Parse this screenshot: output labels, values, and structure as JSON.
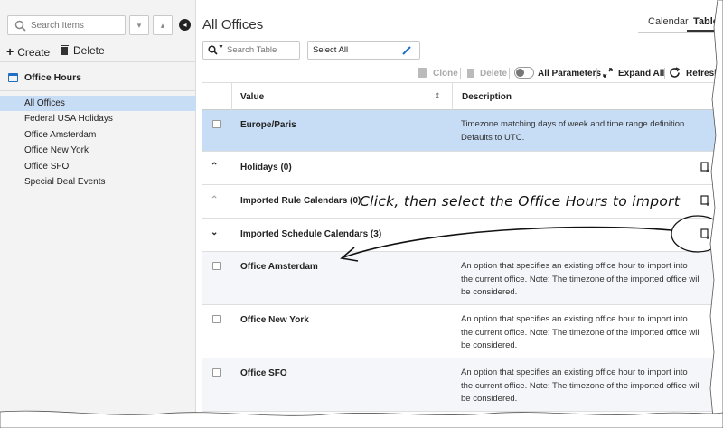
{
  "sidebar": {
    "search_placeholder": "Search Items",
    "create_label": "Create",
    "delete_label": "Delete",
    "section_title": "Office Hours",
    "items": [
      {
        "label": "All Offices",
        "selected": true
      },
      {
        "label": "Federal USA Holidays",
        "selected": false
      },
      {
        "label": "Office Amsterdam",
        "selected": false
      },
      {
        "label": "Office New York",
        "selected": false
      },
      {
        "label": "Office SFO",
        "selected": false
      },
      {
        "label": "Special Deal Events",
        "selected": false
      }
    ]
  },
  "main": {
    "title": "All Offices",
    "tabs": [
      {
        "label": "Calendar",
        "active": false
      },
      {
        "label": "Table",
        "active": true
      }
    ],
    "table_search_placeholder": "Search Table",
    "select_all_label": "Select All",
    "toolbar": {
      "clone_label": "Clone",
      "delete_label": "Delete",
      "all_parameters_label": "All Parameters",
      "expand_all_label": "Expand All",
      "refresh_label": "Refresh"
    },
    "columns": {
      "value": "Value",
      "description": "Description"
    },
    "rows": [
      {
        "type": "item",
        "value": "Europe/Paris",
        "description": "Timezone matching days of week and time range definition. Defaults to UTC."
      },
      {
        "type": "group",
        "label": "Holidays (0)",
        "expanded": true
      },
      {
        "type": "group",
        "label": "Imported Rule Calendars (0)",
        "expanded": true
      },
      {
        "type": "group",
        "label": "Imported Schedule Calendars (3)",
        "expanded": true
      },
      {
        "type": "item",
        "value": "Office Amsterdam",
        "description": "An option that specifies an existing office hour to import into the current office. Note: The timezone of the imported office will be considered."
      },
      {
        "type": "item",
        "value": "Office New York",
        "description": "An option that specifies an existing office hour to import into the current office. Note: The timezone of the imported office will be considered."
      },
      {
        "type": "item",
        "value": "Office SFO",
        "description": "An option that specifies an existing office hour to import into the current office. Note: The timezone of the imported office will be considered."
      }
    ]
  },
  "annotation": "Click, then select the Office Hours to import",
  "colors": {
    "accent": "#1f6fc5",
    "selected_row": "#c7dcf5",
    "sidebar_bg": "#f3f3f3",
    "alt_row": "#f4f6f9"
  },
  "icons": [
    "search-icon",
    "chevron-down-icon",
    "chevron-up-icon",
    "collapse-icon",
    "plus-icon",
    "trash-icon",
    "calendar-icon",
    "pencil-icon",
    "clone-icon",
    "toggle",
    "expand-icon",
    "refresh-icon",
    "sort-icon",
    "add-row-icon"
  ]
}
